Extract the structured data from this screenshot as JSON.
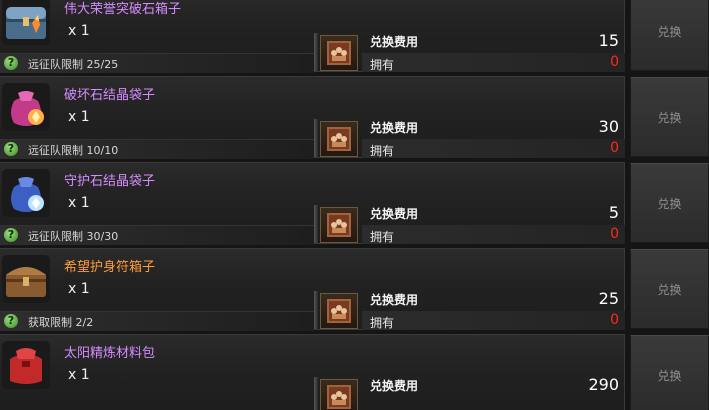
{
  "exchange": {
    "items": [
      {
        "name": "伟大荣誉突破石箱子",
        "name_color": "purple",
        "icon": "treasure-chest-icon",
        "quantity": "x 1",
        "limit_text": "远征队限制 25/25",
        "cost_label": "兑换费用",
        "cost_value": "15",
        "owned_label": "拥有",
        "owned_value": "0",
        "button_label": "兑换"
      },
      {
        "name": "破坏石结晶袋子",
        "name_color": "purple",
        "icon": "pink-crystal-pouch-icon",
        "quantity": "x 1",
        "limit_text": "远征队限制 10/10",
        "cost_label": "兑换费用",
        "cost_value": "30",
        "owned_label": "拥有",
        "owned_value": "0",
        "button_label": "兑换"
      },
      {
        "name": "守护石结晶袋子",
        "name_color": "purple",
        "icon": "blue-crystal-pouch-icon",
        "quantity": "x 1",
        "limit_text": "远征队限制 30/30",
        "cost_label": "兑换费用",
        "cost_value": "5",
        "owned_label": "拥有",
        "owned_value": "0",
        "button_label": "兑换"
      },
      {
        "name": "希望护身符箱子",
        "name_color": "orange",
        "icon": "wooden-chest-icon",
        "quantity": "x 1",
        "limit_text": "获取限制 2/2",
        "cost_label": "兑换费用",
        "cost_value": "25",
        "owned_label": "拥有",
        "owned_value": "0",
        "button_label": "兑换"
      },
      {
        "name": "太阳精炼材料包",
        "name_color": "purple",
        "icon": "red-material-bag-icon",
        "quantity": "x 1",
        "limit_text": "",
        "cost_label": "兑换费用",
        "cost_value": "290",
        "owned_label": "",
        "owned_value": "",
        "button_label": "兑换"
      }
    ],
    "colors": {
      "purple_name": "#d58cff",
      "orange_name": "#ff9d3a",
      "owned_zero": "#ff2a1a",
      "help_icon": "#5fb43e"
    }
  }
}
